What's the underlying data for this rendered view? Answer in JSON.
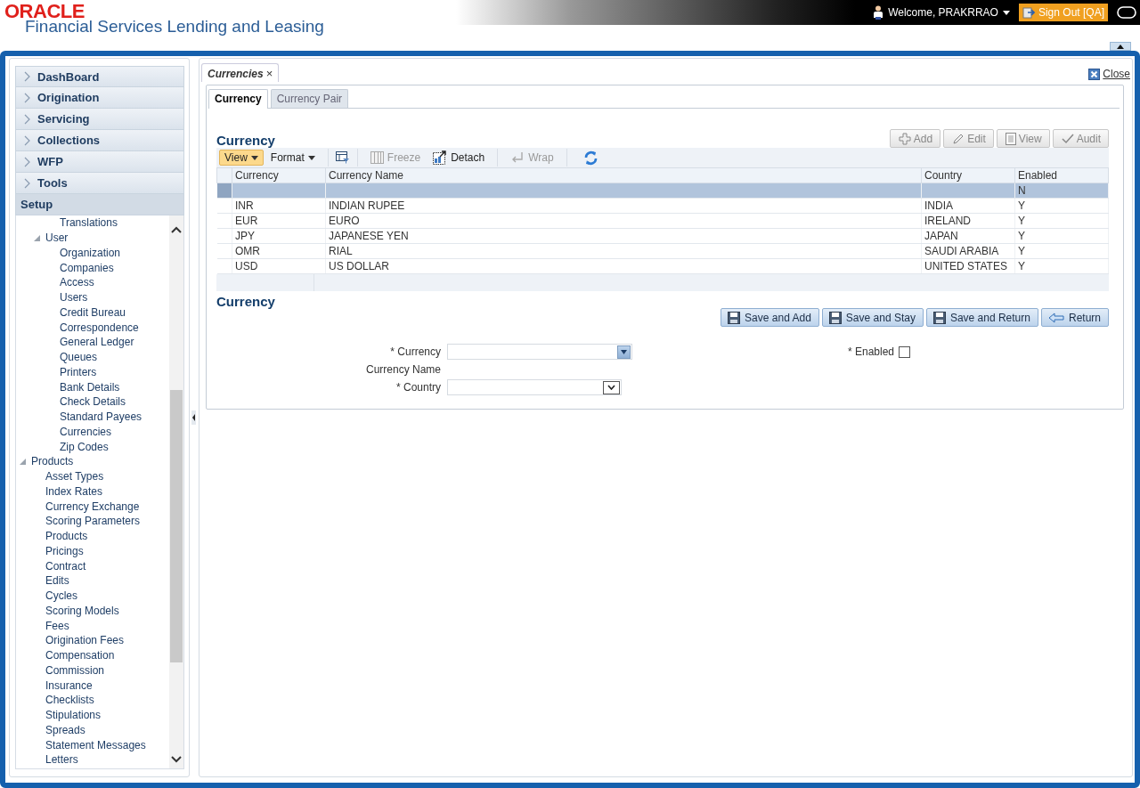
{
  "header": {
    "logo": "ORACLE",
    "product": "Financial Services Lending and Leasing",
    "welcome": "Welcome, PRAKRRAO",
    "sign_out": "Sign Out [QA]"
  },
  "sidebar": {
    "sections": [
      {
        "label": "DashBoard",
        "expanded": false
      },
      {
        "label": "Origination",
        "expanded": false
      },
      {
        "label": "Servicing",
        "expanded": false
      },
      {
        "label": "Collections",
        "expanded": false
      },
      {
        "label": "WFP",
        "expanded": false
      },
      {
        "label": "Tools",
        "expanded": false
      },
      {
        "label": "Setup",
        "expanded": true,
        "tree": [
          {
            "children": [
              {
                "children": [
                  {
                    "label": "Translations"
                  }
                ]
              },
              {
                "label": "User",
                "expanded": true,
                "children": [
                  {
                    "label": "Organization"
                  },
                  {
                    "label": "Companies"
                  },
                  {
                    "label": "Access"
                  },
                  {
                    "label": "Users"
                  },
                  {
                    "label": "Credit Bureau"
                  },
                  {
                    "label": "Correspondence"
                  },
                  {
                    "label": "General Ledger"
                  },
                  {
                    "label": "Queues"
                  },
                  {
                    "label": "Printers"
                  },
                  {
                    "label": "Bank Details"
                  },
                  {
                    "label": "Check Details"
                  },
                  {
                    "label": "Standard Payees"
                  },
                  {
                    "label": "Currencies"
                  },
                  {
                    "label": "Zip Codes"
                  }
                ]
              }
            ]
          },
          {
            "label": "Products",
            "expanded": true,
            "children": [
              {
                "label": "Asset Types"
              },
              {
                "label": "Index Rates"
              },
              {
                "label": "Currency Exchange"
              },
              {
                "label": "Scoring Parameters"
              },
              {
                "label": "Products"
              },
              {
                "label": "Pricings"
              },
              {
                "label": "Contract"
              },
              {
                "label": "Edits"
              },
              {
                "label": "Cycles"
              },
              {
                "label": "Scoring Models"
              },
              {
                "label": "Fees"
              },
              {
                "label": "Origination Fees"
              },
              {
                "label": "Compensation"
              },
              {
                "label": "Commission"
              },
              {
                "label": "Insurance"
              },
              {
                "label": "Checklists"
              },
              {
                "label": "Stipulations"
              },
              {
                "label": "Spreads"
              },
              {
                "label": "Statement Messages"
              },
              {
                "label": "Letters"
              }
            ]
          }
        ]
      }
    ]
  },
  "content": {
    "tab": {
      "label": "Currencies",
      "close": "×"
    },
    "close_label": "Close",
    "subtabs": [
      {
        "label": "Currency",
        "selected": true
      },
      {
        "label": "Currency Pair",
        "selected": false
      }
    ],
    "list": {
      "title": "Currency",
      "actions": [
        {
          "kind": "add",
          "label": "Add"
        },
        {
          "kind": "edit",
          "label": "Edit"
        },
        {
          "kind": "view",
          "label": "View"
        },
        {
          "kind": "audit",
          "label": "Audit"
        }
      ],
      "toolbar": [
        {
          "kind": "menu",
          "label": "View",
          "selected": true
        },
        {
          "kind": "menu",
          "label": "Format",
          "selected": false
        },
        {
          "kind": "filter"
        },
        {
          "kind": "freeze",
          "label": "Freeze",
          "disabled": true
        },
        {
          "kind": "detach",
          "label": "Detach",
          "disabled": false
        },
        {
          "kind": "wrap",
          "label": "Wrap",
          "disabled": true
        },
        {
          "kind": "refresh"
        }
      ],
      "columns": [
        "Currency",
        "Currency Name",
        "Country",
        "Enabled"
      ],
      "rows": [
        {
          "selected": true,
          "cells": [
            "",
            "",
            "",
            "N"
          ]
        },
        {
          "selected": false,
          "cells": [
            "INR",
            "INDIAN RUPEE",
            "INDIA",
            "Y"
          ]
        },
        {
          "selected": false,
          "cells": [
            "EUR",
            "EURO",
            "IRELAND",
            "Y"
          ]
        },
        {
          "selected": false,
          "cells": [
            "JPY",
            "JAPANESE YEN",
            "JAPAN",
            "Y"
          ]
        },
        {
          "selected": false,
          "cells": [
            "OMR",
            "RIAL",
            "SAUDI ARABIA",
            "Y"
          ]
        },
        {
          "selected": false,
          "cells": [
            "USD",
            "US DOLLAR",
            "UNITED STATES",
            "Y"
          ]
        }
      ]
    },
    "form": {
      "title": "Currency",
      "buttons": [
        {
          "kind": "save",
          "label": "Save and Add"
        },
        {
          "kind": "save",
          "label": "Save and Stay"
        },
        {
          "kind": "save",
          "label": "Save and Return"
        },
        {
          "kind": "return",
          "label": "Return"
        }
      ],
      "currency": {
        "label": "* Currency"
      },
      "currency_name": {
        "label": "Currency Name"
      },
      "country": {
        "label": "* Country"
      },
      "enabled": {
        "label": "* Enabled",
        "checked": false
      }
    }
  }
}
